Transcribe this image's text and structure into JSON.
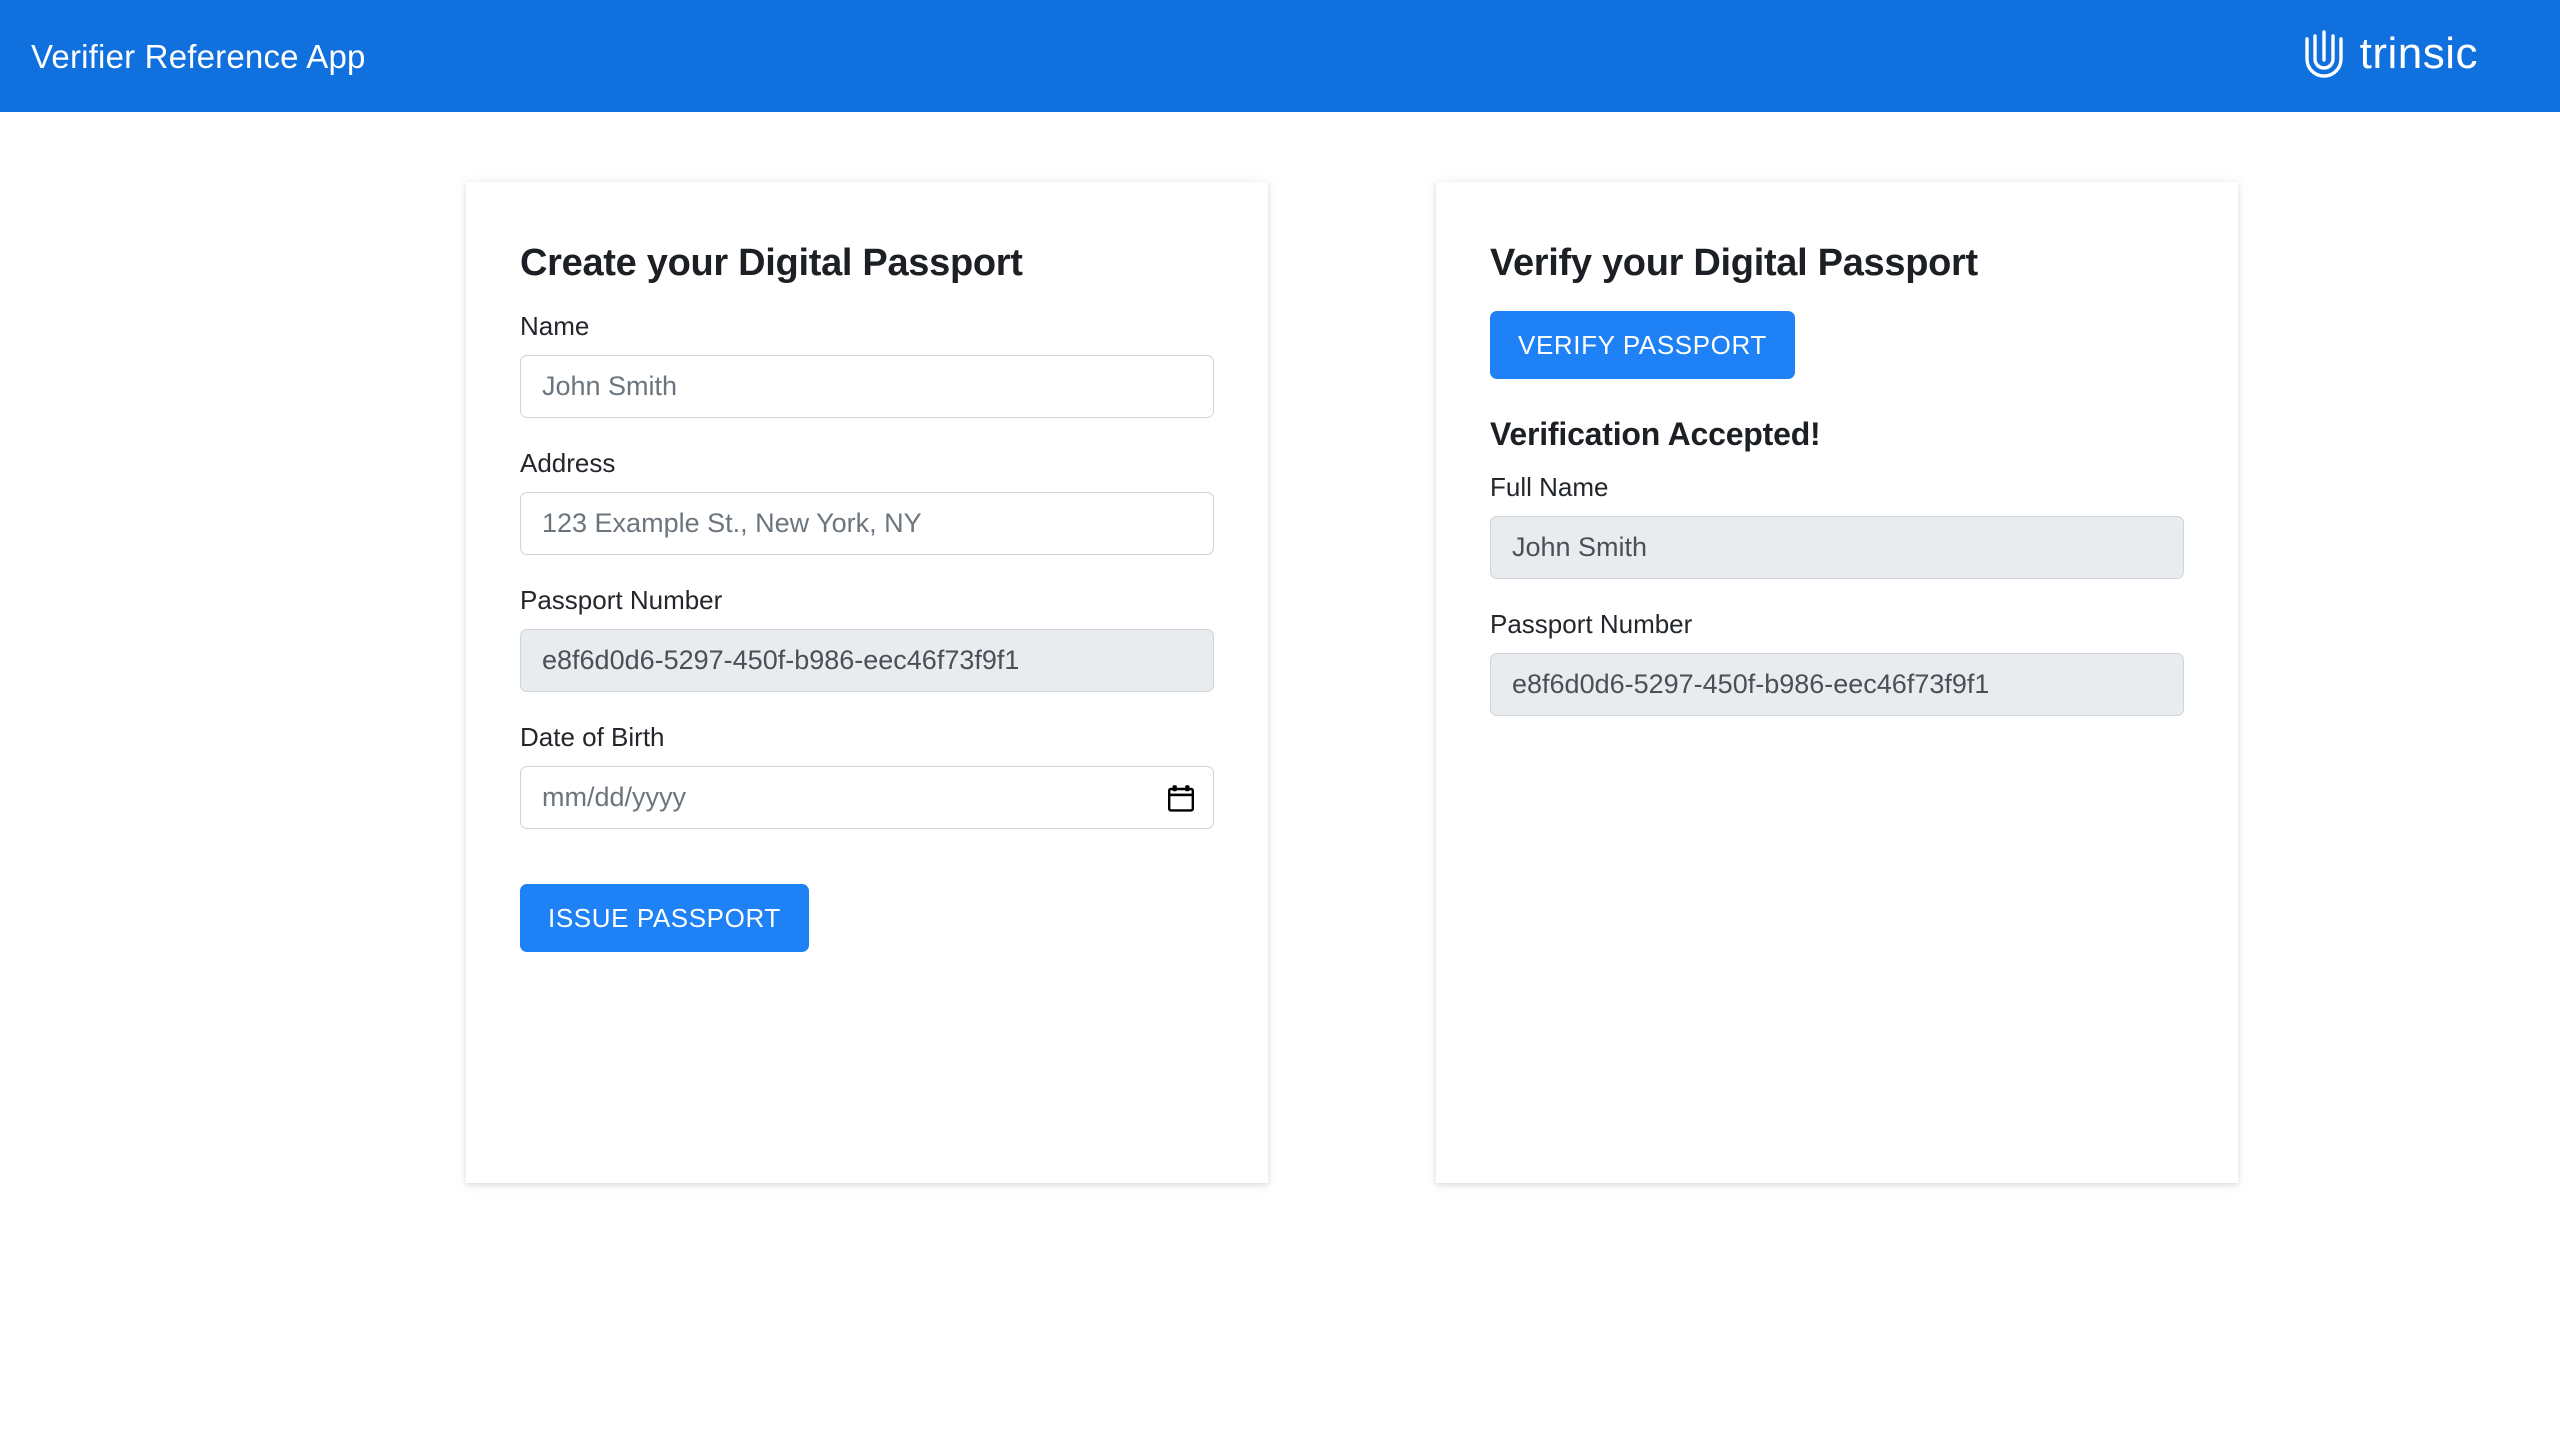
{
  "header": {
    "app_title": "Verifier Reference App",
    "brand_name": "trinsic",
    "brand_logo_icon": "trinsic-hand-icon",
    "background_color": "#1070DE",
    "text_color": "#FFFFFF"
  },
  "theme": {
    "page_background": "#FFFFFF",
    "accent_button_color": "#1E81F5",
    "input_border_color": "#CED4DA",
    "disabled_input_background": "#E9ECEF",
    "label_text_color": "#23272B"
  },
  "issue_card": {
    "title": "Create your Digital Passport",
    "fields": [
      {
        "label": "Name",
        "placeholder": "John Smith",
        "value": "",
        "disabled": false,
        "type": "text"
      },
      {
        "label": "Address",
        "placeholder": "123 Example St., New York, NY",
        "value": "",
        "disabled": false,
        "type": "text"
      },
      {
        "label": "Passport Number",
        "placeholder": "",
        "value": "e8f6d0d6-5297-450f-b986-eec46f73f9f1",
        "disabled": true,
        "type": "text"
      },
      {
        "label": "Date of Birth",
        "placeholder": "mm/dd/yyyy",
        "value": "",
        "disabled": false,
        "type": "date",
        "icon": "calendar-icon"
      }
    ],
    "submit_label": "ISSUE PASSPORT"
  },
  "verify_card": {
    "title": "Verify your Digital Passport",
    "verify_button_label": "VERIFY PASSPORT",
    "result_status": "Verification Accepted!",
    "fields": [
      {
        "label": "Full Name",
        "value": "John Smith",
        "disabled": true
      },
      {
        "label": "Passport Number",
        "value": "e8f6d0d6-5297-450f-b986-eec46f73f9f1",
        "disabled": true
      }
    ]
  }
}
